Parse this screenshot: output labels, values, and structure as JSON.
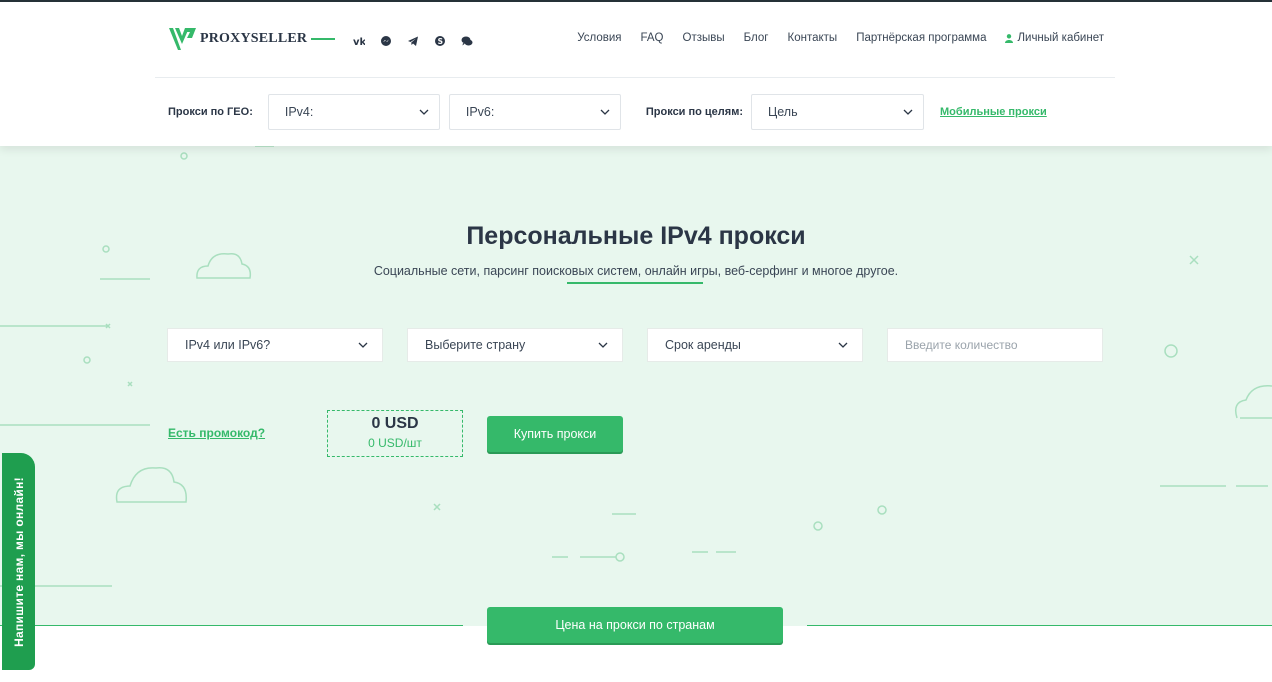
{
  "brand": {
    "logo_text": "PROXYSELLER",
    "accent": "#35b96a",
    "dark": "#2b3646"
  },
  "socials": [
    {
      "name": "vk-icon",
      "glyph": "vk"
    },
    {
      "name": "messenger-icon",
      "glyph": "messenger"
    },
    {
      "name": "telegram-icon",
      "glyph": "telegram"
    },
    {
      "name": "skype-icon",
      "glyph": "skype"
    },
    {
      "name": "chat-icon",
      "glyph": "chat"
    }
  ],
  "nav": {
    "terms": "Условия",
    "faq": "FAQ",
    "reviews": "Отзывы",
    "blog": "Блог",
    "contacts": "Контакты",
    "partner": "Партнёрская программа",
    "cabinet": "Личный кабинет"
  },
  "filters": {
    "geo_label": "Прокси по ГЕО:",
    "ipv4": "IPv4:",
    "ipv6": "IPv6:",
    "goal_label": "Прокси по целям:",
    "goal": "Цель",
    "mobile_link": "Мобильные прокси"
  },
  "hero": {
    "title": "Персональные IPv4 прокси",
    "subtitle": "Социальные сети, парсинг поисковых систем, онлайн игры, веб-серфинг и многое другое."
  },
  "order": {
    "protocol": "IPv4 или IPv6?",
    "country": "Выберите страну",
    "period": "Срок аренды",
    "quantity_placeholder": "Введите количество",
    "promo": "Есть промокод?",
    "price_total": "0 USD",
    "price_unit": "0 USD/шт",
    "buy": "Купить прокси"
  },
  "country_prices_button": "Цена на прокси по странам",
  "chat_widget": "Напишите нам, мы онлайн!"
}
